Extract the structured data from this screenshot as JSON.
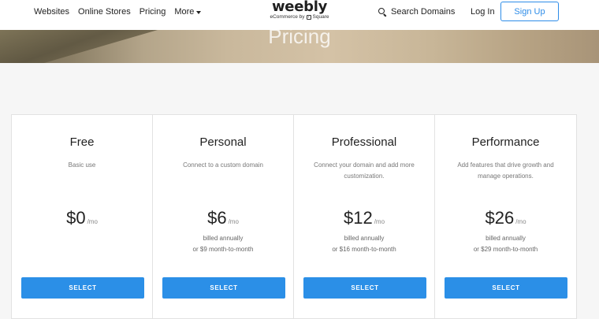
{
  "nav": {
    "websites": "Websites",
    "online_stores": "Online Stores",
    "pricing": "Pricing",
    "more": "More",
    "search_domains": "Search Domains",
    "log_in": "Log In",
    "sign_up": "Sign Up"
  },
  "logo": {
    "word": "weebly",
    "sub_prefix": "eCommerce by",
    "sub_brand": "Square"
  },
  "hero": {
    "title": "Pricing"
  },
  "plans": [
    {
      "name": "Free",
      "desc1": "Basic use",
      "desc2": "",
      "price": "$0",
      "per": "/mo",
      "billing1": "",
      "billing2": "",
      "cta": "SELECT"
    },
    {
      "name": "Personal",
      "desc1": "Connect to a custom domain",
      "desc2": "",
      "price": "$6",
      "per": "/mo",
      "billing1": "billed annually",
      "billing2": "or $9 month-to-month",
      "cta": "SELECT"
    },
    {
      "name": "Professional",
      "desc1": "Connect your domain and add more",
      "desc2": "customization.",
      "price": "$12",
      "per": "/mo",
      "billing1": "billed annually",
      "billing2": "or $16 month-to-month",
      "cta": "SELECT"
    },
    {
      "name": "Performance",
      "desc1": "Add features that drive growth and",
      "desc2": "manage operations.",
      "price": "$26",
      "per": "/mo",
      "billing1": "billed annually",
      "billing2": "or $29 month-to-month",
      "cta": "SELECT"
    }
  ],
  "colors": {
    "accent": "#2b8fe7",
    "signup_border": "#2d8ce8"
  }
}
